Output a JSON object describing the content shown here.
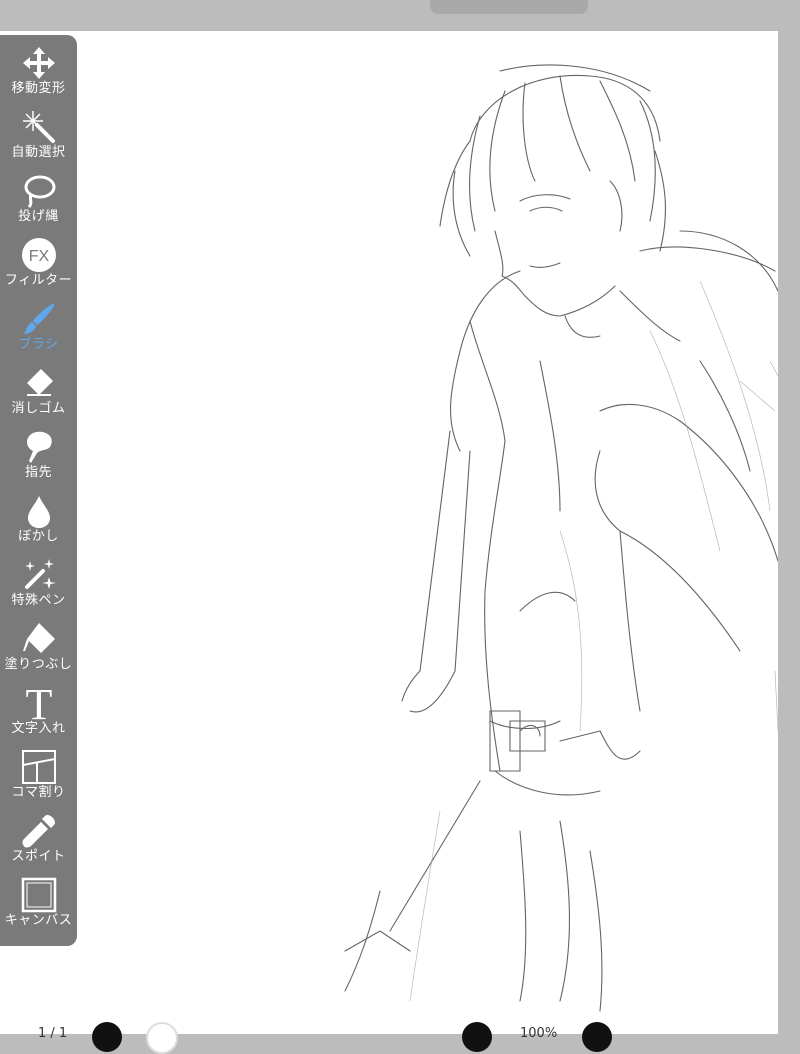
{
  "tools": [
    {
      "id": "move",
      "label": "移動変形",
      "icon": "move-arrows-icon"
    },
    {
      "id": "auto-select",
      "label": "自動選択",
      "icon": "magic-wand-icon"
    },
    {
      "id": "lasso",
      "label": "投げ縄",
      "icon": "lasso-icon"
    },
    {
      "id": "filter",
      "label": "フィルター",
      "icon": "fx-icon"
    },
    {
      "id": "brush",
      "label": "ブラシ",
      "icon": "brush-icon",
      "active": true
    },
    {
      "id": "eraser",
      "label": "消しゴム",
      "icon": "eraser-icon"
    },
    {
      "id": "smudge",
      "label": "指先",
      "icon": "smudge-finger-icon"
    },
    {
      "id": "blur",
      "label": "ぼかし",
      "icon": "droplet-icon"
    },
    {
      "id": "special-pen",
      "label": "特殊ペン",
      "icon": "sparkle-pen-icon"
    },
    {
      "id": "fill",
      "label": "塗りつぶし",
      "icon": "fill-bucket-icon"
    },
    {
      "id": "text",
      "label": "文字入れ",
      "icon": "text-t-icon"
    },
    {
      "id": "frame",
      "label": "コマ割り",
      "icon": "panel-frame-icon"
    },
    {
      "id": "eyedropper",
      "label": "スポイト",
      "icon": "eyedropper-icon"
    },
    {
      "id": "canvas",
      "label": "キャンバス",
      "icon": "canvas-square-icon"
    }
  ],
  "filter_icon_text": "FX",
  "text_icon_glyph": "T",
  "colors": {
    "toolbar_bg": "#7a7a7a",
    "active": "#5fa8ee",
    "frame_bg": "#bcbcbc",
    "canvas": "#ffffff"
  },
  "bottom_bar": {
    "left_text": "1 / 1",
    "zoom_text": "100%"
  }
}
